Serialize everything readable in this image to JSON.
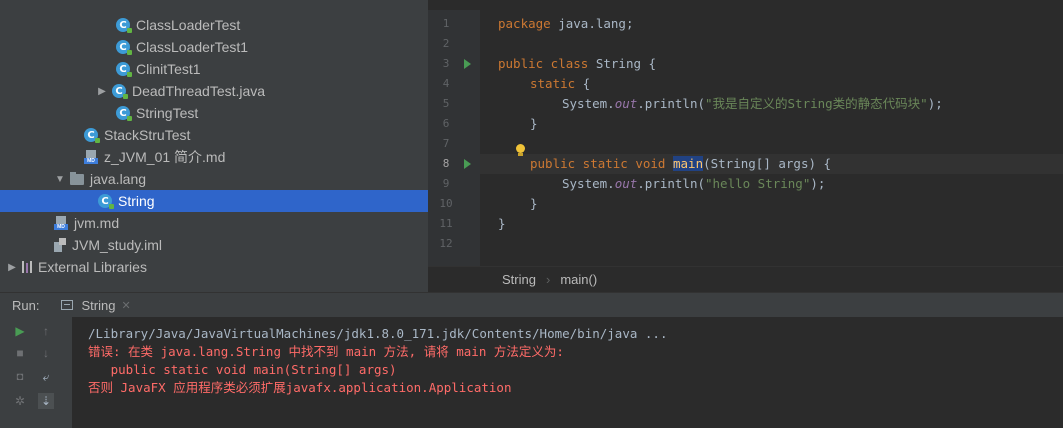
{
  "project_tree": {
    "items": [
      {
        "label": "ClassLoaderTest",
        "type": "class"
      },
      {
        "label": "ClassLoaderTest1",
        "type": "class"
      },
      {
        "label": "ClinitTest1",
        "type": "class"
      },
      {
        "label": "DeadThreadTest.java",
        "type": "class",
        "collapsed": true
      },
      {
        "label": "StringTest",
        "type": "class"
      },
      {
        "label": "StackStruTest",
        "type": "class"
      },
      {
        "label": "z_JVM_01 简介.md",
        "type": "markdown"
      },
      {
        "label": "java.lang",
        "type": "package",
        "expanded": true
      },
      {
        "label": "String",
        "type": "class",
        "selected": true
      },
      {
        "label": "jvm.md",
        "type": "markdown"
      },
      {
        "label": "JVM_study.iml",
        "type": "module"
      },
      {
        "label": "External Libraries",
        "type": "libraries",
        "collapsed": true
      }
    ]
  },
  "editor": {
    "line_numbers": [
      "1",
      "2",
      "3",
      "4",
      "5",
      "6",
      "7",
      "8",
      "9",
      "10",
      "11",
      "12"
    ],
    "code": {
      "l1_kw": "package",
      "l1_rest": " java.lang;",
      "l3_kw": "public class",
      "l3_rest": " String {",
      "l4_kw": "static",
      "l4_rest": " {",
      "l5_a": "System.",
      "l5_field": "out",
      "l5_b": ".println(",
      "l5_str": "\"我是自定义的String类的静态代码块\"",
      "l5_c": ");",
      "l6": "}",
      "l8_kw": "public static void",
      "l8_fn": "main",
      "l8_rest": "(String[] args) {",
      "l9_a": "System.",
      "l9_field": "out",
      "l9_b": ".println(",
      "l9_str": "\"hello String\"",
      "l9_c": ");",
      "l10": "}",
      "l11": "}"
    }
  },
  "breadcrumb": {
    "items": [
      "String",
      "main()"
    ]
  },
  "run_panel": {
    "label": "Run:",
    "tab": "String",
    "console": [
      "/Library/Java/JavaVirtualMachines/jdk1.8.0_171.jdk/Contents/Home/bin/java ...",
      "错误: 在类 java.lang.String 中找不到 main 方法, 请将 main 方法定义为:",
      "   public static void main(String[] args)",
      "否则 JavaFX 应用程序类必须扩展javafx.application.Application"
    ]
  },
  "colors": {
    "selection": "#2f65ca",
    "error_text": "#ff6b68",
    "keyword": "#cc7832",
    "string": "#6a8759"
  }
}
